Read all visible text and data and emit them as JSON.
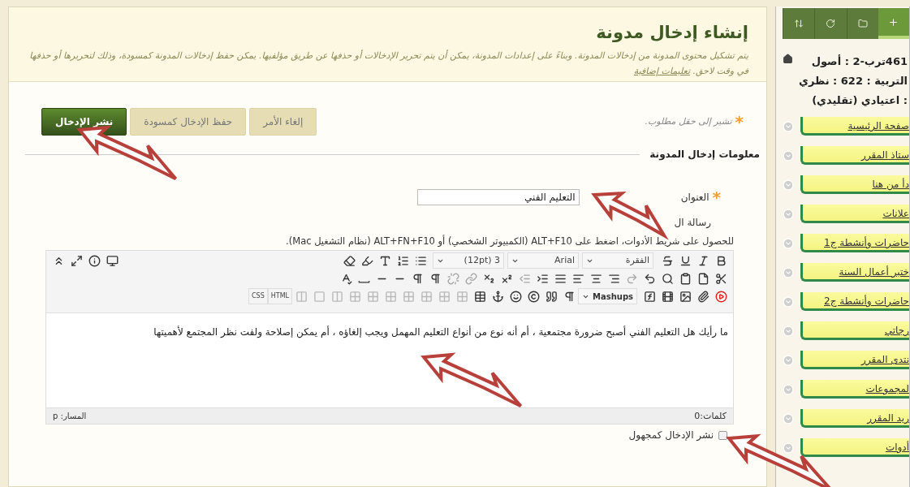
{
  "header": {
    "title": "إنشاء إدخال مدونة",
    "description": "يتم تشكيل محتوى المدونة من إدخالات المدونة. وبناءً على إعدادات المدونة، يمكن أن يتم تحرير الإدخالات أو حذفها عن طريق مؤلفيها. يمكن حفظ إدخالات المدونة كمسودة، وذلك لتحريرها أو حذفها في وقت لاحق.",
    "help_link": "تعليمات إضافية"
  },
  "required_note": {
    "mark": "*",
    "text": "تشير إلى حقل مطلوب."
  },
  "buttons": [
    {
      "label": "إلغاء الأمر",
      "kind": "secondary"
    },
    {
      "label": "حفظ الإدخال كمسودة",
      "kind": "secondary"
    },
    {
      "label": "نشر الإدخال",
      "kind": "primary"
    }
  ],
  "section": {
    "title": "معلومات إدخال المدونة"
  },
  "title_field": {
    "required_mark": "*",
    "label": "العنوان",
    "value": "التعليم الفني"
  },
  "message": {
    "label": "رسالة ال",
    "hint": "للحصول على شريط الأدوات، اضغط على ALT+F10 (الكمبيوتر الشخصي) أو ALT+FN+F10 (نظام التشغيل Mac).",
    "toolbar": {
      "paragraph": "الفقرة",
      "font": "Arial",
      "size": "3 (12pt)",
      "mashups": "Mashups",
      "html": "HTML",
      "css": "CSS"
    },
    "content": "ما رأيك هل التعليم الفني أصبح ضرورة مجتمعية ، أم أنه نوع من أنواع التعليم المهمل ويجب إلغاؤه ، أم يمكن إصلاحة ولفت نظر المجتمع لأهميتها",
    "word_count": "كلمات:0",
    "path": "المسار: p"
  },
  "anonymous": {
    "label": "نشر الإدخال كمجهول",
    "checked": false
  },
  "sidebar": {
    "course_title": "461ترب-2 : أصول التربية : 622 : نظري : اعتيادي (تقليدي)",
    "items": [
      {
        "label": "صفحة الرئيسية"
      },
      {
        "label": "ستاذ المقرر"
      },
      {
        "label": "دأ من هنا"
      },
      {
        "label": "علانات"
      },
      {
        "label": "حاضرات وأنشطة ج1"
      },
      {
        "label": "ختبر أعمال السنة"
      },
      {
        "label": "حاضرات وأنشطة ج2"
      },
      {
        "label": "رجاتي"
      },
      {
        "label": "نتدى المقرر"
      },
      {
        "label": "لمجموعات"
      },
      {
        "label": "ريد المقرر"
      },
      {
        "label": "أدوات"
      }
    ]
  }
}
